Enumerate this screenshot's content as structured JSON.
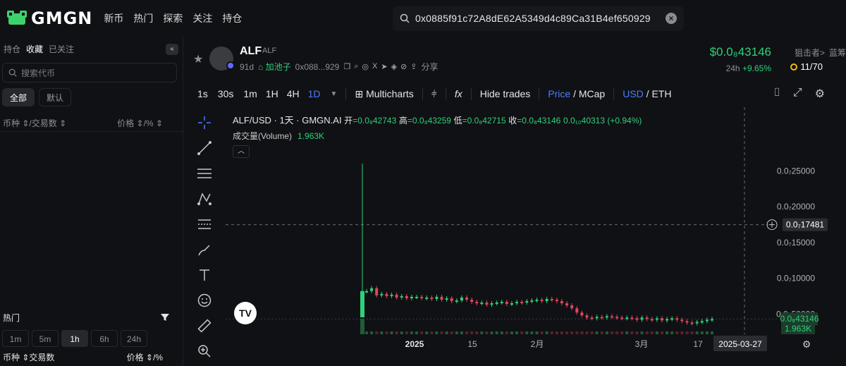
{
  "app": {
    "logo_text": "GMGN"
  },
  "nav": [
    "新币",
    "热门",
    "探索",
    "关注",
    "持仓"
  ],
  "search": {
    "value": "0x0885f91c72A8dE62A5349d4c89Ca31B4ef650929"
  },
  "sidebar": {
    "tabs": [
      "持仓",
      "收藏",
      "已关注"
    ],
    "active_tab": "收藏",
    "search_placeholder": "搜索代币",
    "filters": [
      "全部",
      "默认"
    ],
    "col_token": "币种",
    "col_volume": "/交易数",
    "col_price": "价格",
    "col_change": "/%",
    "hot": {
      "title": "热门",
      "timeframes": [
        "1m",
        "5m",
        "1h",
        "6h",
        "24h"
      ],
      "active_tf": "1h",
      "col_token": "币种",
      "col_volume": "交易数",
      "col_price": "价格",
      "col_change": "/%"
    }
  },
  "token": {
    "name": "ALF",
    "symbol": "ALF",
    "age": "91d",
    "pool": "加池子",
    "address_short": "0x088...929",
    "share": "分享",
    "price": "$0.0₈43146",
    "change_label": "24h",
    "change_value": "+9.65%",
    "snipers_label": "狙击者>",
    "snipers_value": "11/70",
    "extra_label": "蓝筹"
  },
  "chart_toolbar": {
    "intervals": [
      "1s",
      "30s",
      "1m",
      "1H",
      "4H",
      "1D"
    ],
    "active_interval": "1D",
    "multicharts": "Multicharts",
    "fx": "fx",
    "hide_trades": "Hide trades",
    "price_label": "Price",
    "mcap_label": "MCap",
    "usd_label": "USD",
    "eth_label": "ETH"
  },
  "chart_legend": {
    "pair": "ALF/USD · 1天 · GMGN.AI",
    "open_label": "开",
    "open": "=0.0₈42743",
    "high_label": "高",
    "high": "=0.0₈43259",
    "low_label": "低",
    "low": "=0.0₈42715",
    "close_label": "收",
    "close": "=0.0₈43146",
    "delta": "0.0₁₀40313 (+0.94%)",
    "volume_label": "成交量(Volume)",
    "volume_value": "1.963K"
  },
  "chart_data": {
    "type": "candlestick",
    "y_ticks": [
      "0.0₇25000",
      "0.0₇20000",
      "0.0₇15000",
      "0.0₇10000",
      "0.0₈50000"
    ],
    "y_tick_values": [
      25000,
      20000,
      15000,
      10000,
      5000
    ],
    "x_ticks": [
      "2025",
      "15",
      "2月",
      "3月",
      "17"
    ],
    "crosshair_price": "0.0₇17481",
    "crosshair_price_value": 17481,
    "crosshair_date": "2025-03-27",
    "last_price": "0.0₈43146",
    "last_price_value": 4315,
    "volume_label": "1.963K",
    "spike_high": 26000,
    "candles": [
      8200,
      8600,
      7600,
      7800,
      7500,
      7700,
      7300,
      7500,
      7200,
      7400,
      7400,
      7200,
      7300,
      7100,
      7400,
      7000,
      7200,
      6800,
      6900,
      7300,
      7000,
      6700,
      6500,
      6600,
      6300,
      6500,
      6600,
      6700,
      6400,
      6500,
      6700,
      6600,
      6800,
      6900,
      7000,
      6800,
      7100,
      7000,
      6800,
      6500,
      6200,
      5800,
      5200,
      4800,
      4500,
      4400,
      4600,
      4500,
      4700,
      4600,
      4500,
      4400,
      4500,
      4400,
      4200,
      4500,
      4300,
      4200,
      4400,
      4100,
      4300,
      4400,
      4200,
      4000,
      3800,
      3700,
      3900,
      4000,
      4200,
      4300
    ]
  }
}
